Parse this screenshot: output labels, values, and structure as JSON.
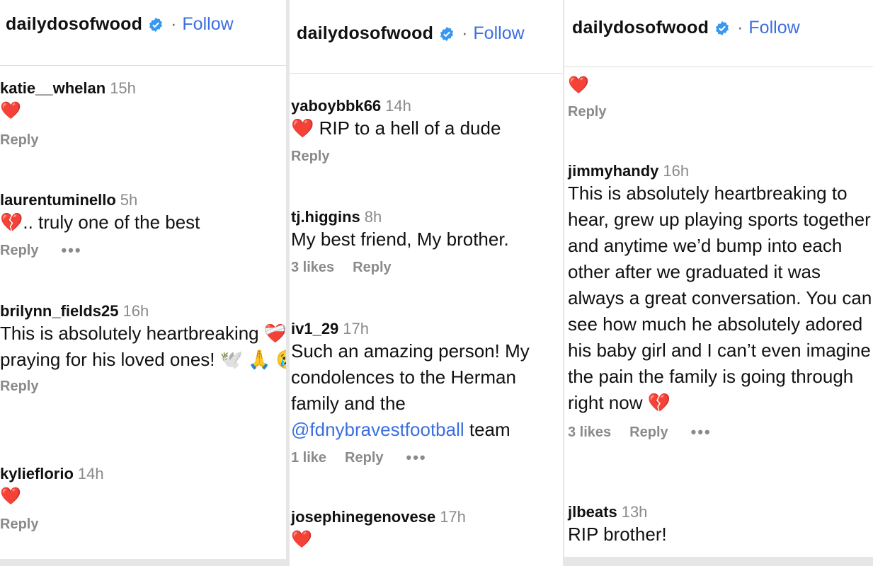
{
  "header": {
    "username": "dailydosofwood",
    "separator": "·",
    "follow_label": "Follow"
  },
  "panel1": {
    "comments": [
      {
        "user": "katie__whelan",
        "time": "15h",
        "text": "❤️",
        "reply": "Reply"
      },
      {
        "user": "laurentuminello",
        "time": "5h",
        "text": "💔.. truly one of the best",
        "reply": "Reply",
        "more": "•••"
      },
      {
        "user": "brilynn_fields25",
        "time": "16h",
        "text": "This is absolutely heartbreaking ❤️‍🩹 praying for his loved ones! 🕊️ 🙏 😢",
        "reply": "Reply"
      },
      {
        "user": "kylieflorio",
        "time": "14h",
        "text": "❤️",
        "reply": "Reply"
      }
    ]
  },
  "panel2": {
    "comments": [
      {
        "user": "yaboybbk66",
        "time": "14h",
        "text": "❤️ RIP to a hell of a dude",
        "reply": "Reply"
      },
      {
        "user": "tj.higgins",
        "time": "8h",
        "text": "My best friend, My brother.",
        "likes": "3 likes",
        "reply": "Reply"
      },
      {
        "user": "iv1_29",
        "time": "17h",
        "text_before": "Such an amazing person! My condolences to the Herman family and the ",
        "mention": "@fdnybravestfootball",
        "text_after": " team",
        "likes": "1 like",
        "reply": "Reply",
        "more": "•••"
      },
      {
        "user": "josephinegenovese",
        "time": "17h",
        "text": "❤️"
      }
    ]
  },
  "panel3": {
    "comments": [
      {
        "text": "❤️",
        "reply": "Reply"
      },
      {
        "user": "jimmyhandy",
        "time": "16h",
        "text": "This is absolutely heartbreaking to hear, grew up playing sports together and anytime we’d bump into each other after we graduated it was always a great conversation. You can see how much he absolutely adored his baby girl and I can’t even imagine the pain the family is going through right now 💔",
        "likes": "3 likes",
        "reply": "Reply",
        "more": "•••"
      },
      {
        "user": "jlbeats",
        "time": "13h",
        "text": "RIP brother!"
      }
    ]
  },
  "colors": {
    "link": "#3b6fe0",
    "muted": "#8a8a8a",
    "heart": "#e8202a"
  }
}
